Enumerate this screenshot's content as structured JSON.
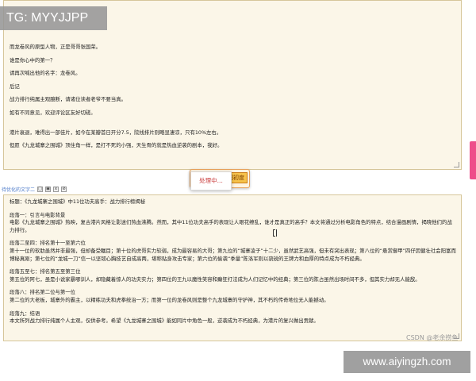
{
  "watermark": {
    "top_left": "TG: MYYJJPP",
    "csdn": "CSDN @老余捞鱼",
    "site": "www.aiyingzh.com"
  },
  "top_editor": {
    "paragraphs": [
      "而龙卷风的原型人物，正是哥哥张国荣。",
      "谁是你心中的第一？",
      "请再次喊出他的名字：龙卷风。",
      "后记",
      "战力排行纯属主观臆断，请诸位读者老爷不要当真。",
      "如有不同意见，欢迎评论区友好切磋。",
      "港片衰退，难得出一部佳片，如今在某瓣首日开分7.5，院线排片则略显凄凉，只有10%左右。",
      "但愿《九龙城寨之围城》顶住角一样，是打不死的小强，天生骨的就是热血逆袭的剧本，我好。"
    ]
  },
  "process_button": {
    "label": "处理中...",
    "label_short": "图初度"
  },
  "label_row": {
    "text": "待优化的文字二",
    "icons": [
      "□",
      "▣",
      "x",
      "⊘"
    ]
  },
  "bottom_editor": {
    "paragraphs": [
      "标题：《九龙城寨之围城》中11位功夫高手：战力排行榜揭秘",
      "段落一：引言与电影背景\n电影《九龙城寨之围城》热映，复古港片风格让影迷们热血沸腾。然而，其中11位功夫高手的表现让人眼花缭乱，谁才是真正的高手？本文将通过分析电影角色的特点，结合漫画剧情，揭晓他们的战力排行。",
      "段落二至四：排名第十一至第六位\n第十一位的软肋虽然并非最强，但却备受瞩目；第十位的虎哥实力较弱，成为最容易的大哥；第九位的“城寨凌子”十二少，虽然武艺高强，但未有突出表现；第八位的“悬赏御甲”四仔因健壮社会阳富而博秘真刚；第七位的“龙城一刀”信一以坚韧心胸技艺自成高两，堪称贴身攻击专家；第六位的偷袭“季量”陈洛军则以骁锐的王牌力和血厚的特点成为不朽经典。",
      "段落五至七：排名第五至第三位\n第五位的阿七，虽是小说家暴哪训人，却隐藏着惊人的功夫实力；第四位的王九以魔性笑容和癫狂打法成为人们记忆中的经典；第三位的陈占虽然出场时间不多，但其实力却无人能敌。",
      "段落八：排名第二位与第一位\n第二位的大老板，城寨外的霸主，以精练功夫和虎拳统治一方；而第一位的龙卷风则是整个九龙城寨的守护神，其不朽的传奇地位无人能撼动。",
      "段落九：结语\n本文所列战力排行纯属个人主观，仅供参考。希望《九龙城寨之围城》能如同片中角色一般，逆袭成为不朽经典，为港片的复兴做出贡献。"
    ]
  },
  "colors": {
    "panel_bg": "#fbf6e8",
    "panel_border": "#d6c69a",
    "button_orange": "#f6c24a",
    "side_tab_pink": "#ee4d8a",
    "label_blue": "#4a78c8"
  }
}
